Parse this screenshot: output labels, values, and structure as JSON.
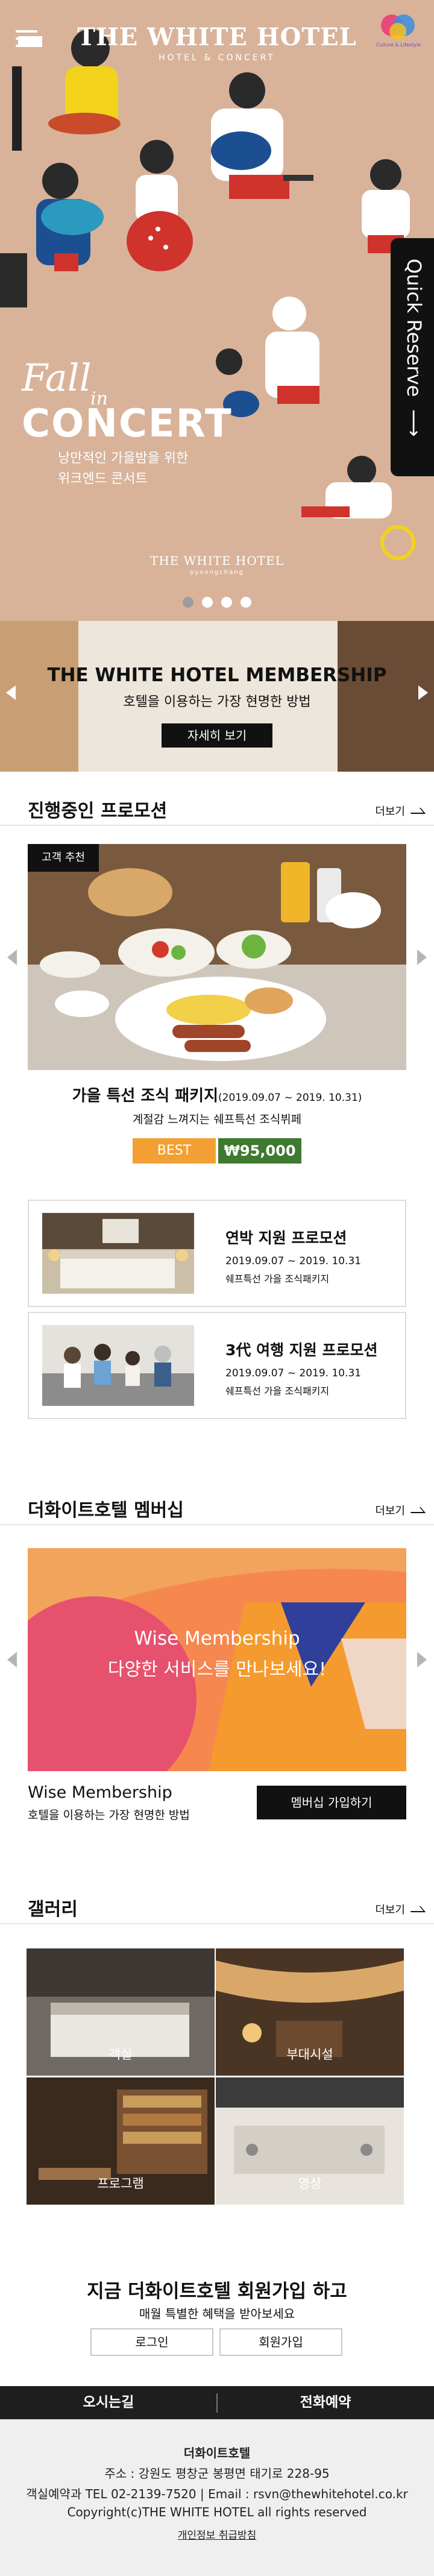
{
  "header": {
    "logo_title": "THE WHITE HOTEL",
    "logo_sub": "HOTEL & CONCERT",
    "badge_text": "Culture & Lifestyle"
  },
  "hero": {
    "fall": "Fall",
    "in": "in",
    "concert": "CONCERT",
    "desc_line1": "낭만적인 가을밤을 위한",
    "desc_line2": "위크엔드 콘서트",
    "brand": "THE WHITE HOTEL",
    "brand_sub": "pyeongchang",
    "slides_total": 4,
    "slide_active": 1,
    "quick_reserve": "Quick Reserve"
  },
  "membership_banner": {
    "title": "THE WHITE HOTEL MEMBERSHIP",
    "desc": "호텔을 이용하는 가장 현명한 방법",
    "button": "자세히 보기"
  },
  "promotion": {
    "section_title": "진행중인 프로모션",
    "more": "더보기",
    "tag": "고객 추천",
    "name": "가을 특선 조식 패키지",
    "period": "(2019.09.07 ~ 2019. 10.31)",
    "desc": "계절감 느껴지는 쉐프특선 조식뷔페",
    "badge": "BEST",
    "price": "₩95,000",
    "cards": [
      {
        "title": "연박 지원 프로모션",
        "date": "2019.09.07 ~ 2019. 10.31",
        "desc": "쉐프특선 가을 조식패키지"
      },
      {
        "title": "3代 여행 지원 프로모션",
        "date": "2019.09.07 ~ 2019. 10.31",
        "desc": "쉐프특선 가을 조식패키지"
      }
    ]
  },
  "membership": {
    "section_title": "더화이트호텔 멤버십",
    "more": "더보기",
    "banner_title": "Wise Membership",
    "banner_sub": "다양한 서비스를 만나보세요!",
    "name": "Wise Membership",
    "desc": "호텔을 이용하는 가장 현명한 방법",
    "button": "멤버십 가입하기"
  },
  "gallery": {
    "section_title": "갤러리",
    "more": "더보기",
    "tiles": [
      "객실",
      "부대시설",
      "프로그램",
      "영상"
    ]
  },
  "signup": {
    "title": "지금 더화이트호텔 회원가입 하고",
    "desc": "매월 특별한 혜택을 받아보세요",
    "login": "로그인",
    "join": "회원가입"
  },
  "footer": {
    "directions": "오시는길",
    "phone_reserve": "전화예약",
    "brand": "더화이트호텔",
    "address": "주소 : 강원도 평창군 봉평면 태기로 228-95",
    "contact": "객실예약과 TEL 02-2139-7520 | Email : rsvn@thewhitehotel.co.kr",
    "copyright": "Copyright(c)THE WHITE HOTEL all rights reserved",
    "policy": "개인정보 취급방침"
  },
  "colors": {
    "hero_bg": "#d8b39a",
    "best_badge": "#f2a033",
    "price_badge": "#3e7a2f",
    "dark": "#111111"
  }
}
